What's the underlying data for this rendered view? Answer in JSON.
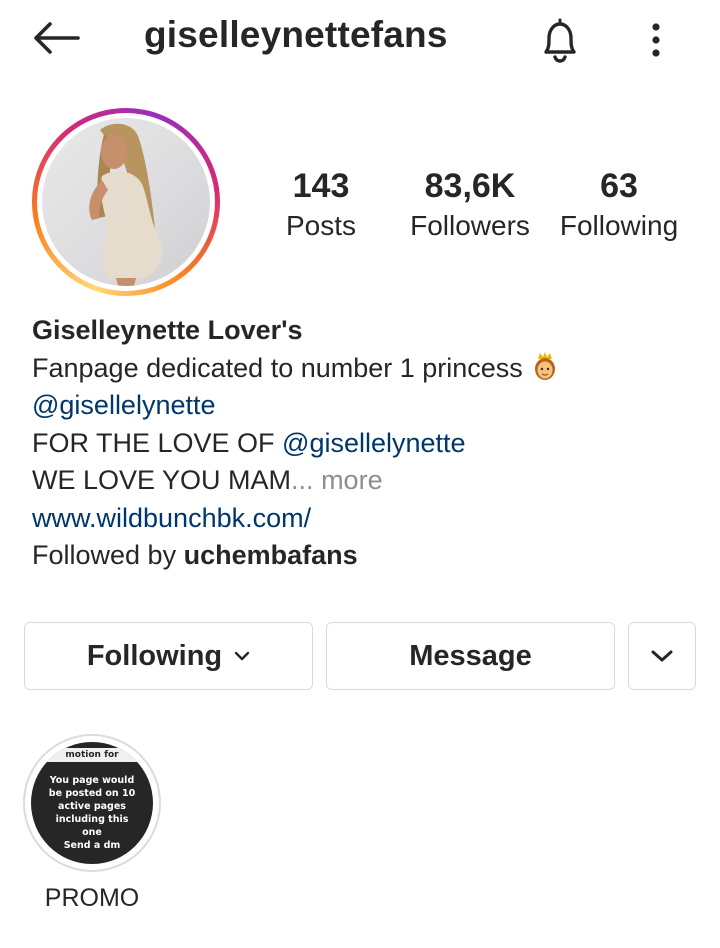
{
  "header": {
    "username": "giselleynettefans",
    "back_icon": "arrow-left-icon",
    "bell_icon": "bell-icon",
    "more_icon": "vertical-dots-icon"
  },
  "stats": {
    "posts": {
      "value": "143",
      "label": "Posts"
    },
    "followers": {
      "value": "83,6K",
      "label": "Followers"
    },
    "following": {
      "value": "63",
      "label": "Following"
    }
  },
  "bio": {
    "name": "Giselleynette Lover's",
    "line1": "Fanpage dedicated to number 1  princess",
    "mention1": "@gisellelynette",
    "line3_prefix": "FOR THE LOVE OF ",
    "mention2": "@gisellelynette",
    "line4": "WE LOVE YOU MAM",
    "ellipsis": "...",
    "more": " more",
    "website": "www.wildbunchbk.com/",
    "followed_by_prefix": "Followed by ",
    "followed_by_user": "uchembafans"
  },
  "actions": {
    "following_label": "Following",
    "message_label": "Message"
  },
  "highlights": [
    {
      "label": "PROMO",
      "cover_top": "motion for",
      "cover_text": "You page would be posted on 10 active pages including this one",
      "cover_dm": "Send a dm"
    }
  ],
  "colors": {
    "text": "#262626",
    "link": "#00376b",
    "muted": "#8e8e8e",
    "border": "#dbdbdb"
  }
}
